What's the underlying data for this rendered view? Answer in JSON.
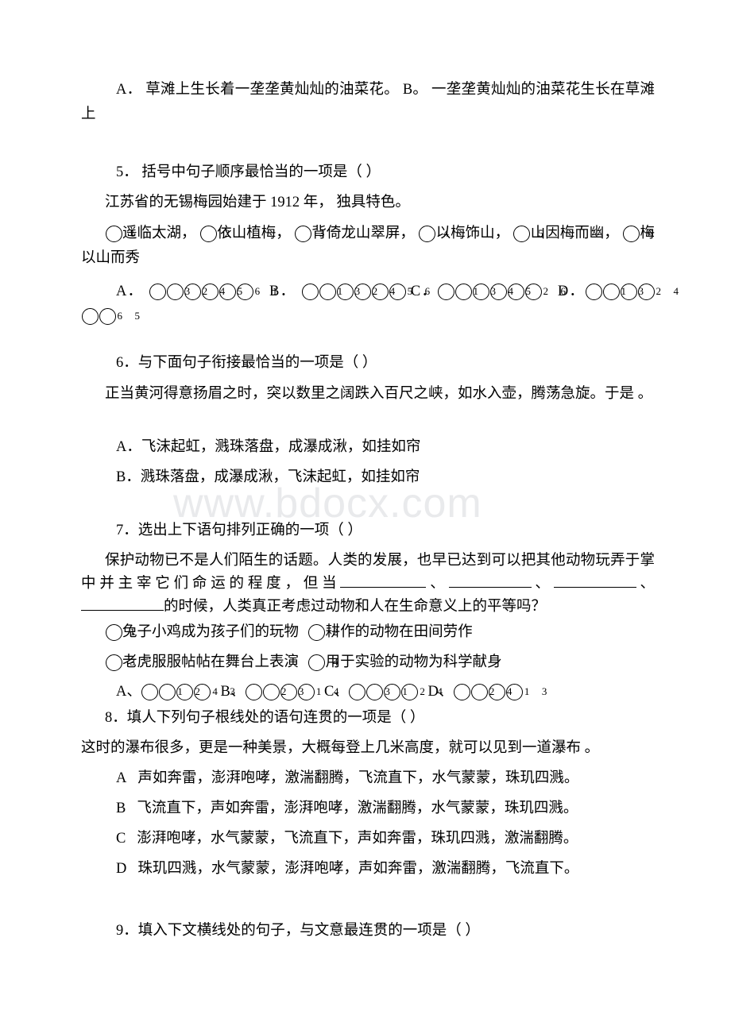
{
  "document": {
    "watermark": "www.bdocx.com",
    "background_color": "#ffffff",
    "text_color": "#000000",
    "watermark_color": "#e9eaec"
  },
  "q4_tail": {
    "options_line": "A． 草滩上生长着一垄垄黄灿灿的油菜花。 B。 一垄垄黄灿灿的油菜花生长在草滩上"
  },
  "q5": {
    "stem": "5． 括号中句子顺序最恰当的一项是（ ）",
    "passage": "江苏省的无锡梅园始建于 1912 年， 独具特色。",
    "items_prefix": "",
    "items": [
      {
        "num": "1",
        "text": "遥临太湖，"
      },
      {
        "num": "2",
        "text": "依山植梅，"
      },
      {
        "num": "3",
        "text": "背倚龙山翠屏，"
      },
      {
        "num": "4",
        "text": "以梅饰山，"
      },
      {
        "num": "5",
        "text": "山因梅而幽，"
      },
      {
        "num": "6",
        "text": "梅以山而秀"
      }
    ],
    "answers": [
      {
        "label": "A．",
        "nums": [
          "3",
          "2",
          "4",
          "5",
          "6",
          "1"
        ]
      },
      {
        "label": "B．",
        "nums": [
          "1",
          "3",
          "2",
          "4",
          "5",
          "6"
        ]
      },
      {
        "label": "C．",
        "nums": [
          "1",
          "3",
          "4",
          "5",
          "2",
          "6"
        ]
      },
      {
        "label": "D．",
        "nums": [
          "1",
          "3",
          "2",
          "4",
          "6",
          "5"
        ]
      }
    ]
  },
  "q6": {
    "stem": "6．与下面句子衔接最恰当的一项是（ ）",
    "passage": "正当黄河得意扬眉之时，突以数里之阔跌入百尺之峡，如水入壶，腾荡急旋。于是 。",
    "options": [
      "A．飞沫起虹，溅珠落盘，成瀑成湫，如挂如帘",
      "B．溅珠落盘，成瀑成湫，飞沫起虹，如挂如帘"
    ]
  },
  "q7": {
    "stem": "7．选出上下语句排列正确的一项（ ）",
    "passage_part1": "保护动物已不是人们陌生的话题。人类的发展，也早已达到可以把其他动物玩弄于掌中并主宰它们命运的程度，但当",
    "passage_sep": "、",
    "passage_part2": "的时候，人类真正考虑过动物和人在生命意义上的平等吗？",
    "blank_count": 4,
    "items_line1": [
      {
        "num": "1",
        "text": "兔子小鸡成为孩子们的玩物"
      },
      {
        "num": "2",
        "text": "耕作的动物在田间劳作"
      }
    ],
    "items_line2": [
      {
        "num": "3",
        "text": "老虎服服帖帖在舞台上表演"
      },
      {
        "num": "4",
        "text": "用于实验的动物为科学献身"
      }
    ],
    "answers": [
      {
        "label": "A、",
        "nums": [
          "1",
          "2",
          "4",
          "3"
        ]
      },
      {
        "label": "B、",
        "nums": [
          "2",
          "3",
          "1",
          "4"
        ]
      },
      {
        "label": "C、",
        "nums": [
          "3",
          "1",
          "2",
          "4"
        ]
      },
      {
        "label": "D、",
        "nums": [
          "2",
          "4",
          "1",
          "3"
        ]
      }
    ]
  },
  "q8": {
    "stem": "8．填人下列句子根线处的语句连贯的一项是（ ）",
    "passage": "这时的瀑布很多，更是一种美景，大概每登上几米高度，就可以见到一道瀑布 。",
    "options": [
      {
        "label": "A",
        "text": "声如奔雷，澎湃咆哮，激湍翻腾，飞流直下，水气蒙蒙，珠玑四溅。"
      },
      {
        "label": "B",
        "text": "飞流直下，声如奔雷，澎湃咆哮，激湍翻腾，水气蒙蒙，珠玑四溅。"
      },
      {
        "label": "C",
        "text": "澎湃咆哮，水气蒙蒙，飞流直下，声如奔雷，珠玑四溅，激湍翻腾。"
      },
      {
        "label": "D",
        "text": "珠玑四溅，水气蒙蒙，澎湃咆哮，声如奔雷，激湍翻腾，飞流直下。"
      }
    ]
  },
  "q9": {
    "stem": "9．填入下文横线处的句子，与文意最连贯的一项是（ ）"
  }
}
